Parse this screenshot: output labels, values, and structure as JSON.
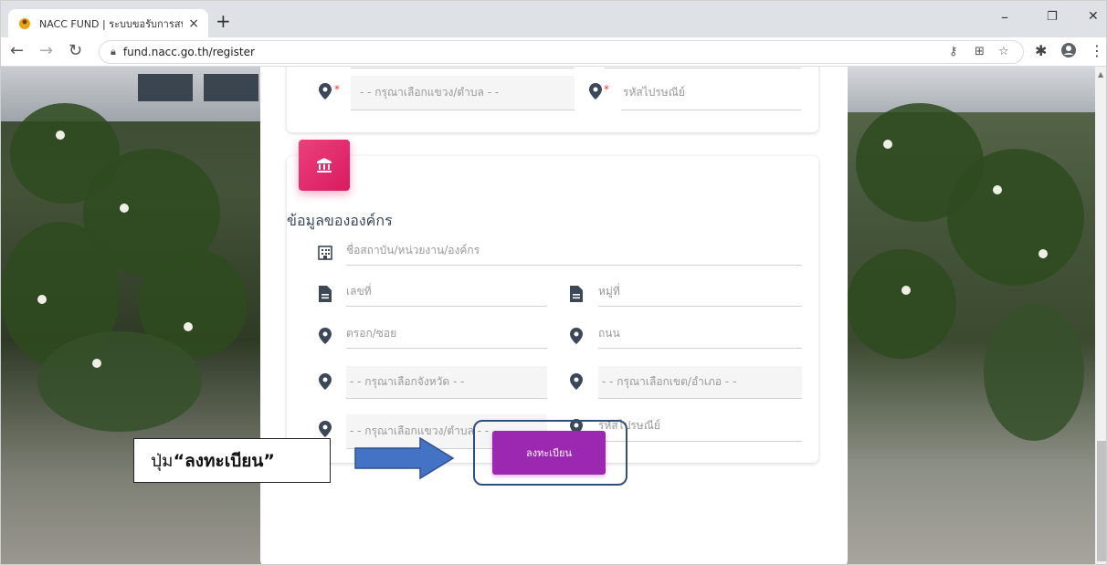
{
  "browser": {
    "tab_title": "NACC FUND | ระบบขอรับการสนับส",
    "tab_close": "×",
    "new_tab": "+",
    "url": "fund.nacc.go.th/register",
    "win_minimize": "–",
    "win_restore": "❐",
    "win_close": "✕"
  },
  "form_top": {
    "subdistrict_placeholder": "- - กรุณาเลือกแขวง/ตำบล - -",
    "postcode_placeholder": "รหัสไปรษณีย์"
  },
  "org_section": {
    "title": "ข้อมูลขององค์กร",
    "org_name_placeholder": "ชื่อสถาบัน/หน่วยงาน/องค์กร",
    "house_no_placeholder": "เลขที่",
    "moo_placeholder": "หมู่ที่",
    "soi_placeholder": "ตรอก/ซอย",
    "road_placeholder": "ถนน",
    "province_placeholder": "- - กรุณาเลือกจังหวัด - -",
    "district_placeholder": "- - กรุณาเลือกเขต/อำเภอ - -",
    "subdistrict_placeholder": "- - กรุณาเลือกแขวง/ตำบล - -",
    "postcode_placeholder": "รหัสไปรษณีย์"
  },
  "register_button_label": "ลงทะเบียน",
  "annotation": {
    "prefix": "ปุ่ม ",
    "label": "“ลงทะเบียน”"
  },
  "colors": {
    "accent_pink": "#e91e63",
    "button_purple": "#9c27b0",
    "arrow_blue": "#4472c4"
  }
}
